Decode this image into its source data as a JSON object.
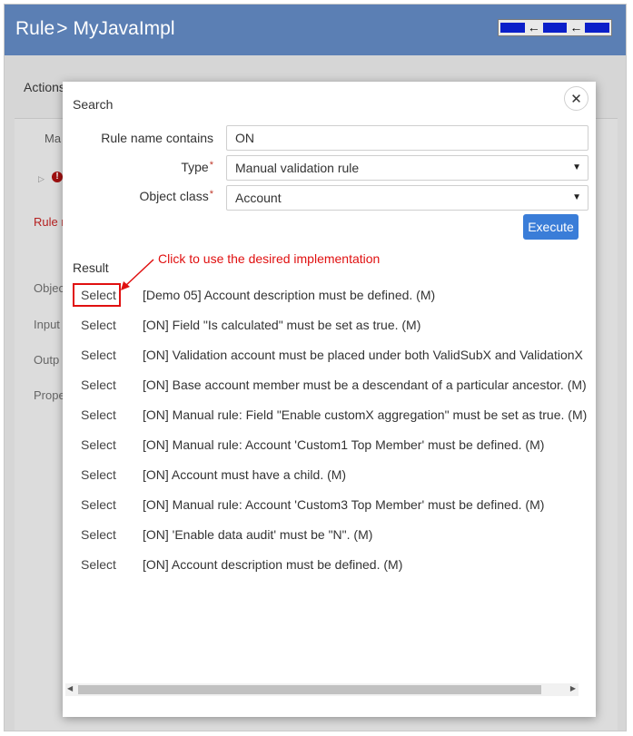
{
  "header": {
    "prefix": "Rule",
    "separator": ">",
    "title": "MyJavaImpl",
    "nav_arrows": [
      "←",
      "←"
    ]
  },
  "background": {
    "actions_label": "Actions",
    "tab_label": "Ma",
    "error_glyph": "!",
    "rule_text": "Rule r",
    "labels": [
      "Objec",
      "Input",
      "Outp",
      "Prope"
    ]
  },
  "modal": {
    "title": "Search",
    "close_glyph": "✕",
    "fields": {
      "name": {
        "label": "Rule name contains",
        "value": "ON"
      },
      "type": {
        "label": "Type",
        "required_mark": "*",
        "value": "Manual validation rule"
      },
      "object_class": {
        "label": "Object class",
        "required_mark": "*",
        "value": "Account"
      }
    },
    "select_arrow": "▼",
    "execute_label": "Execute",
    "result_label": "Result",
    "annotation": "Click to use the desired implementation",
    "results": [
      {
        "action": "Select",
        "text": "[Demo 05] Account description must be defined. (M)"
      },
      {
        "action": "Select",
        "text": "[ON] Field \"Is calculated\" must be set as true. (M)"
      },
      {
        "action": "Select",
        "text": "[ON] Validation account must be placed under both ValidSubX and ValidationX"
      },
      {
        "action": "Select",
        "text": "[ON] Base account member must be a descendant of a particular ancestor. (M)"
      },
      {
        "action": "Select",
        "text": "[ON] Manual rule: Field \"Enable customX aggregation\" must be set as true. (M)"
      },
      {
        "action": "Select",
        "text": "[ON] Manual rule: Account 'Custom1 Top Member' must be defined. (M)"
      },
      {
        "action": "Select",
        "text": "[ON] Account must have a child. (M)"
      },
      {
        "action": "Select",
        "text": "[ON] Manual rule: Account 'Custom3 Top Member' must be defined. (M)"
      },
      {
        "action": "Select",
        "text": "[ON] 'Enable data audit' must be \"N\". (M)"
      },
      {
        "action": "Select",
        "text": "[ON] Account description must be defined. (M)"
      }
    ],
    "scroll_left_glyph": "◀",
    "scroll_right_glyph": "▶"
  },
  "colors": {
    "header_bg": "#5b7fb4",
    "execute_bg": "#3a7dd8",
    "annotation": "#e01010",
    "required": "#c0392b"
  }
}
